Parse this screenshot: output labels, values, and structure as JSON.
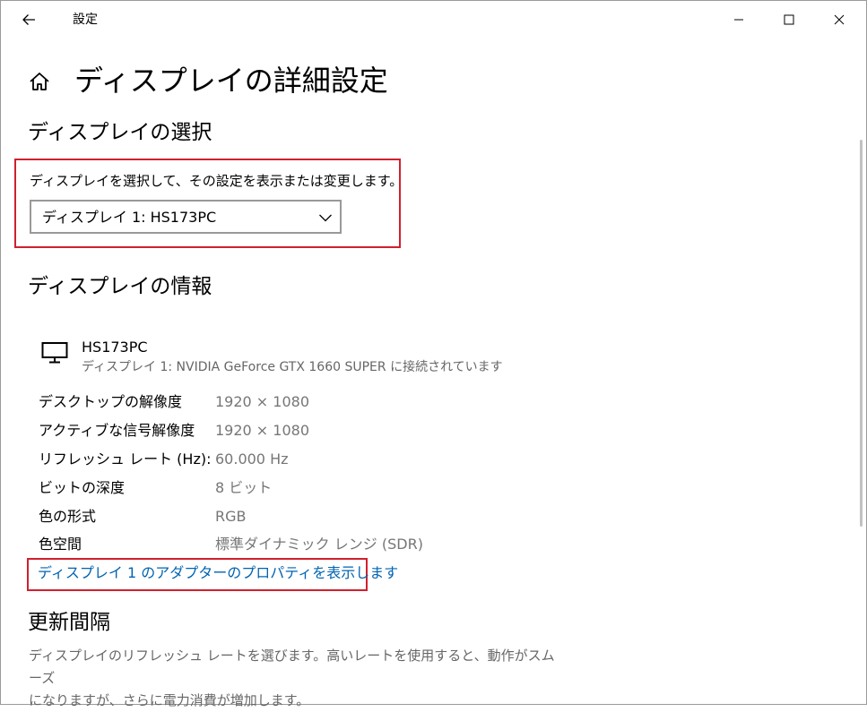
{
  "window": {
    "title": "設定",
    "controls": [
      "minimize",
      "maximize",
      "close"
    ]
  },
  "page": {
    "title": "ディスプレイの詳細設定"
  },
  "display_select": {
    "heading": "ディスプレイの選択",
    "description": "ディスプレイを選択して、その設定を表示または変更します。",
    "selected": "ディスプレイ 1: HS173PC"
  },
  "display_info": {
    "heading": "ディスプレイの情報",
    "monitor_name": "HS173PC",
    "monitor_connection": "ディスプレイ 1: NVIDIA GeForce GTX 1660 SUPER に接続されています",
    "rows": [
      {
        "label": "デスクトップの解像度",
        "value": "1920 × 1080"
      },
      {
        "label": "アクティブな信号解像度",
        "value": "1920 × 1080"
      },
      {
        "label": "リフレッシュ レート (Hz):",
        "value": "60.000 Hz"
      },
      {
        "label": "ビットの深度",
        "value": "8 ビット"
      },
      {
        "label": "色の形式",
        "value": "RGB"
      },
      {
        "label": "色空間",
        "value": "標準ダイナミック レンジ (SDR)"
      }
    ],
    "adapter_link": "ディスプレイ 1 のアダプターのプロパティを表示します"
  },
  "refresh_rate": {
    "heading": "更新間隔",
    "description_line1": "ディスプレイのリフレッシュ レートを選びます。高いレートを使用すると、動作がスムーズ",
    "description_line2": "になりますが、さらに電力消費が増加します。"
  },
  "colors": {
    "link": "#0063b1",
    "highlight": "#d0202e",
    "secondary_text": "#767676"
  }
}
